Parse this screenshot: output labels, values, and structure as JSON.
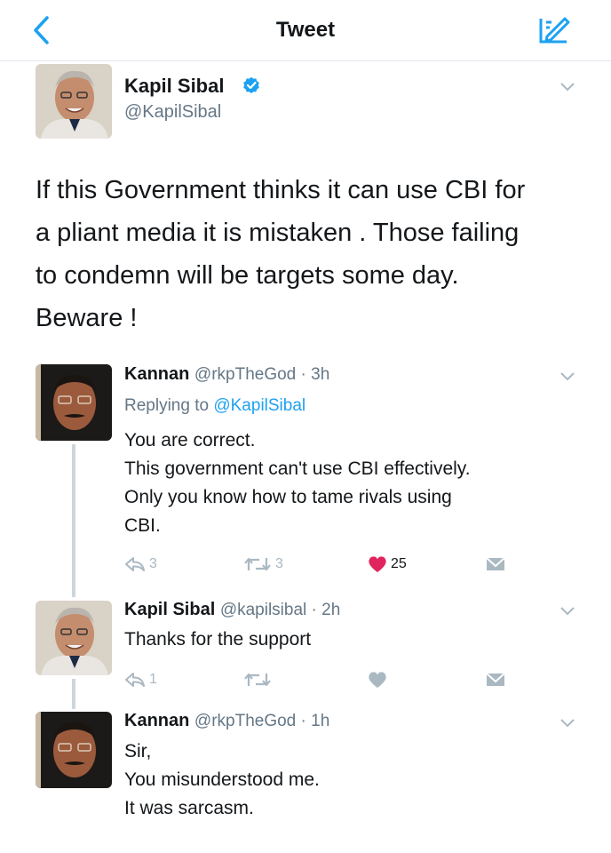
{
  "header": {
    "title": "Tweet"
  },
  "main_tweet": {
    "name": "Kapil Sibal",
    "handle": "@KapilSibal",
    "text_lines": [
      "If this Government thinks it can use CBI for",
      "a pliant media it is mistaken . Those failing",
      "to condemn will be targets some day.",
      "Beware !"
    ]
  },
  "replies": [
    {
      "name": "Kannan",
      "meta": "@rkpTheGod · 3h",
      "replying_prefix": "Replying to",
      "replying_to": "@KapilSibal",
      "body_lines": [
        "You are correct.",
        "This government can't use CBI effectively.",
        "Only you know how to tame rivals using",
        "CBI."
      ],
      "reply_count": "3",
      "retweet_count": "3",
      "like_count": "25"
    },
    {
      "name": "Kapil Sibal",
      "meta": "@kapilsibal · 2h",
      "body_lines": [
        "Thanks for the support"
      ],
      "reply_count": "1"
    },
    {
      "name": "Kannan",
      "meta": "@rkpTheGod · 1h",
      "body_lines": [
        "Sir,",
        "You misunderstood me.",
        "It was sarcasm."
      ]
    }
  ],
  "icons": {
    "back": "chevron-left-icon",
    "compose": "compose-tweet-icon",
    "verified": "verified-badge-icon",
    "reply": "reply-icon",
    "retweet": "retweet-icon",
    "like": "heart-icon",
    "dm": "direct-message-icon",
    "more": "chevron-down-icon"
  },
  "colors": {
    "accent": "#1da1f2",
    "like": "#e0245e",
    "secondary_text": "#657786",
    "icon_gray": "#aab8c2"
  }
}
